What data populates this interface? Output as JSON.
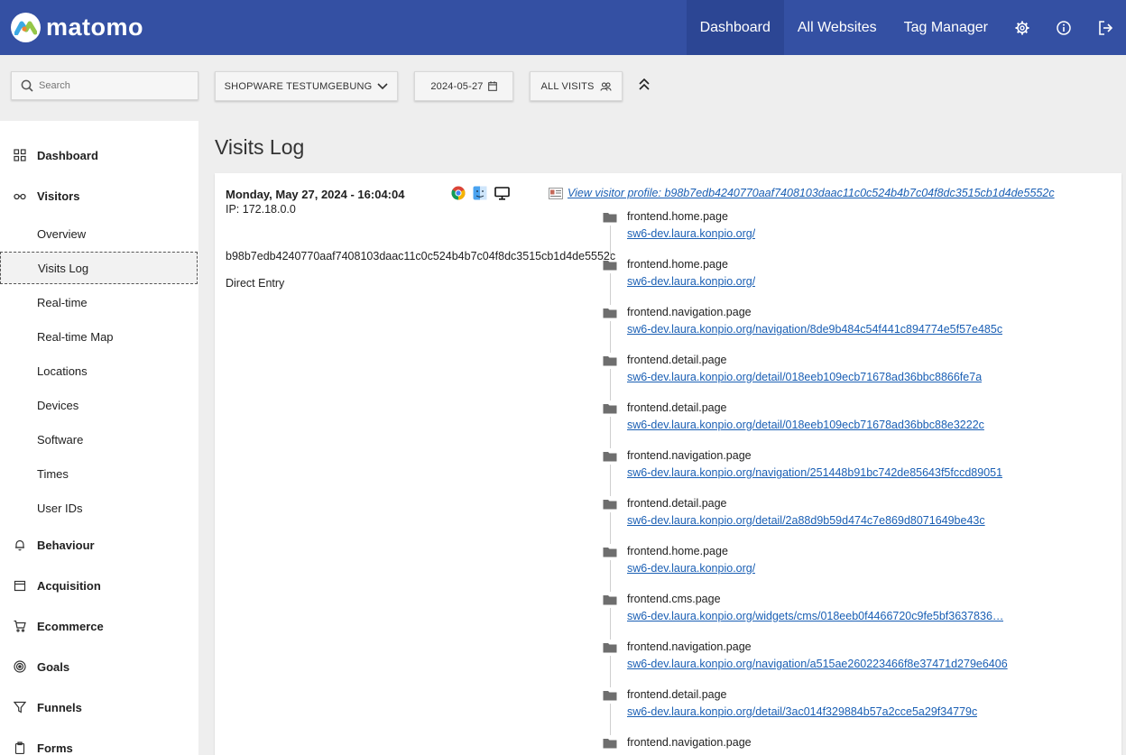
{
  "brand": {
    "name": "matomo"
  },
  "topnav": {
    "dashboard": "Dashboard",
    "all_websites": "All Websites",
    "tag_manager": "Tag Manager",
    "icons": [
      "gear-icon",
      "info-icon",
      "logout-icon"
    ]
  },
  "controls": {
    "search_placeholder": "Search",
    "site": "SHOPWARE TESTUMGEBUNG",
    "date": "2024-05-27",
    "segment": "ALL VISITS"
  },
  "sidebar": {
    "categories": [
      {
        "label": "Dashboard",
        "icon": "grid-icon"
      },
      {
        "label": "Visitors",
        "icon": "glasses-icon"
      },
      {
        "label": "Behaviour",
        "icon": "bell-icon"
      },
      {
        "label": "Acquisition",
        "icon": "calendar-icon"
      },
      {
        "label": "Ecommerce",
        "icon": "cart-icon"
      },
      {
        "label": "Goals",
        "icon": "target-icon"
      },
      {
        "label": "Funnels",
        "icon": "funnel-icon"
      },
      {
        "label": "Forms",
        "icon": "clipboard-icon"
      }
    ],
    "visitor_items": [
      "Overview",
      "Visits Log",
      "Real-time",
      "Real-time Map",
      "Locations",
      "Devices",
      "Software",
      "Times",
      "User IDs"
    ],
    "active_item": "Visits Log"
  },
  "main": {
    "title": "Visits Log",
    "visit": {
      "datetime": "Monday, May 27, 2024 - 16:04:04",
      "ip": "IP: 172.18.0.0",
      "visitor_id": "b98b7edb4240770aaf7408103daac11c0c524b4b7c04f8dc3515cb1d4de5552c",
      "referrer": "Direct Entry",
      "profile_link": "View visitor profile: b98b7edb4240770aaf7408103daac11c0c524b4b7c04f8dc3515cb1d4de5552c",
      "device_icons": [
        "chrome-icon",
        "macos-icon",
        "desktop-icon"
      ],
      "actions": [
        {
          "name": "frontend.home.page",
          "url": "sw6-dev.laura.konpio.org/"
        },
        {
          "name": "frontend.home.page",
          "url": "sw6-dev.laura.konpio.org/"
        },
        {
          "name": "frontend.navigation.page",
          "url": "sw6-dev.laura.konpio.org/navigation/8de9b484c54f441c894774e5f57e485c"
        },
        {
          "name": "frontend.detail.page",
          "url": "sw6-dev.laura.konpio.org/detail/018eeb109ecb71678ad36bbc8866fe7a"
        },
        {
          "name": "frontend.detail.page",
          "url": "sw6-dev.laura.konpio.org/detail/018eeb109ecb71678ad36bbc88e3222c"
        },
        {
          "name": "frontend.navigation.page",
          "url": "sw6-dev.laura.konpio.org/navigation/251448b91bc742de85643f5fccd89051"
        },
        {
          "name": "frontend.detail.page",
          "url": "sw6-dev.laura.konpio.org/detail/2a88d9b59d474c7e869d8071649be43c"
        },
        {
          "name": "frontend.home.page",
          "url": "sw6-dev.laura.konpio.org/"
        },
        {
          "name": "frontend.cms.page",
          "url": "sw6-dev.laura.konpio.org/widgets/cms/018eeb0f4466720c9fe5bf3637836…"
        },
        {
          "name": "frontend.navigation.page",
          "url": "sw6-dev.laura.konpio.org/navigation/a515ae260223466f8e37471d279e6406"
        },
        {
          "name": "frontend.detail.page",
          "url": "sw6-dev.laura.konpio.org/detail/3ac014f329884b57a2cce5a29f34779c"
        },
        {
          "name": "frontend.navigation.page",
          "url": ""
        }
      ]
    }
  }
}
